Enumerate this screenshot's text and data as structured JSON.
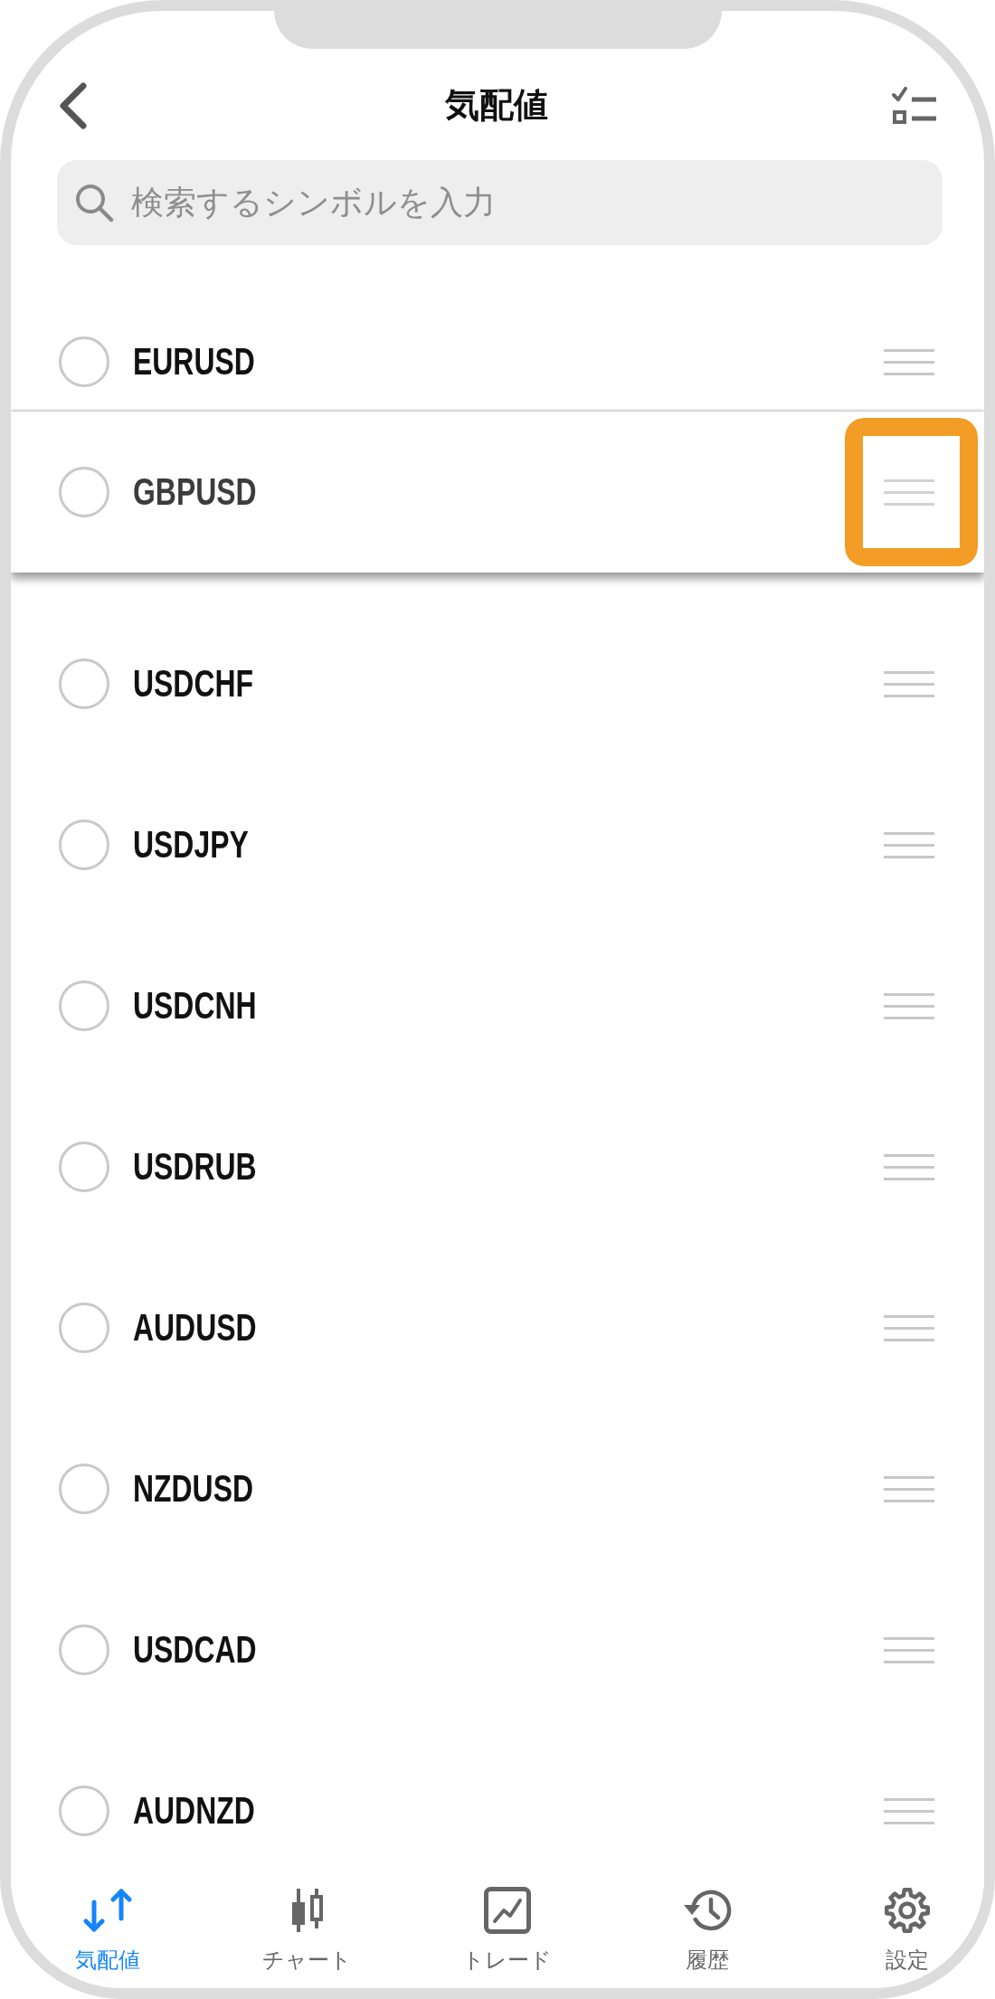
{
  "header": {
    "title": "気配値"
  },
  "search": {
    "placeholder": "検索するシンボルを入力"
  },
  "symbols": [
    {
      "name": "EURUSD",
      "checked": false,
      "dragging": false,
      "highlighted": false
    },
    {
      "name": "GBPUSD",
      "checked": false,
      "dragging": true,
      "highlighted": true
    },
    {
      "name": "USDCHF",
      "checked": false,
      "dragging": false,
      "highlighted": false
    },
    {
      "name": "USDJPY",
      "checked": false,
      "dragging": false,
      "highlighted": false
    },
    {
      "name": "USDCNH",
      "checked": false,
      "dragging": false,
      "highlighted": false
    },
    {
      "name": "USDRUB",
      "checked": false,
      "dragging": false,
      "highlighted": false
    },
    {
      "name": "AUDUSD",
      "checked": false,
      "dragging": false,
      "highlighted": false
    },
    {
      "name": "NZDUSD",
      "checked": false,
      "dragging": false,
      "highlighted": false
    },
    {
      "name": "USDCAD",
      "checked": false,
      "dragging": false,
      "highlighted": false
    },
    {
      "name": "AUDNZD",
      "checked": false,
      "dragging": false,
      "highlighted": false
    }
  ],
  "tab_bar": [
    {
      "kind": "quotes",
      "label": "気配値",
      "selected": true
    },
    {
      "kind": "chart",
      "label": "チャート",
      "selected": false
    },
    {
      "kind": "trade",
      "label": "トレード",
      "selected": false
    },
    {
      "kind": "history",
      "label": "履歴",
      "selected": false
    },
    {
      "kind": "settings",
      "label": "設定",
      "selected": false
    }
  ]
}
